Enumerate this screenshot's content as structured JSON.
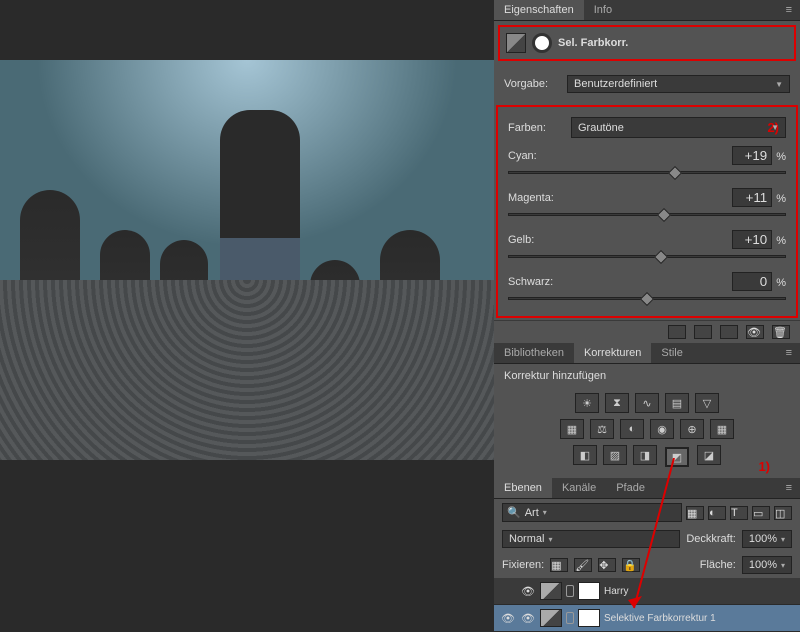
{
  "properties": {
    "tabs": [
      "Eigenschaften",
      "Info"
    ],
    "active_tab": "Eigenschaften",
    "adjustment_label": "Sel. Farbkorr.",
    "preset_label": "Vorgabe:",
    "preset_value": "Benutzerdefiniert",
    "colors_label": "Farben:",
    "colors_value": "Grautöne",
    "annotation_2": "2)",
    "sliders": [
      {
        "name": "Cyan:",
        "value": "+19",
        "pct": "%",
        "pos": 60
      },
      {
        "name": "Magenta:",
        "value": "+11",
        "pct": "%",
        "pos": 56
      },
      {
        "name": "Gelb:",
        "value": "+10",
        "pct": "%",
        "pos": 55
      },
      {
        "name": "Schwarz:",
        "value": "0",
        "pct": "%",
        "pos": 50
      }
    ]
  },
  "libraries": {
    "tabs": [
      "Bibliotheken",
      "Korrekturen",
      "Stile"
    ],
    "active_tab": "Korrekturen",
    "add_label": "Korrektur hinzufügen",
    "annotation_1": "1)",
    "icons": {
      "row1": [
        "brightness",
        "levels",
        "curves",
        "exposure",
        "vibrance"
      ],
      "row2": [
        "hue",
        "balance",
        "bw",
        "photo-filter",
        "channel-mixer",
        "lut"
      ],
      "row3": [
        "invert",
        "posterize",
        "threshold",
        "selective-color",
        "gradient-map"
      ]
    }
  },
  "layers": {
    "tabs": [
      "Ebenen",
      "Kanäle",
      "Pfade"
    ],
    "active_tab": "Ebenen",
    "search_label": "Art",
    "blend_mode": "Normal",
    "opacity_label": "Deckkraft:",
    "opacity_value": "100%",
    "lock_label": "Fixieren:",
    "fill_label": "Fläche:",
    "fill_value": "100%",
    "items": [
      {
        "name": "Harry",
        "visible": false,
        "type": "adjustment",
        "selected": false
      },
      {
        "name": "Selektive Farbkorrektur 1",
        "visible": true,
        "type": "adjustment",
        "selected": true
      }
    ]
  },
  "colors": {
    "red_annotation": "#dd0000"
  }
}
